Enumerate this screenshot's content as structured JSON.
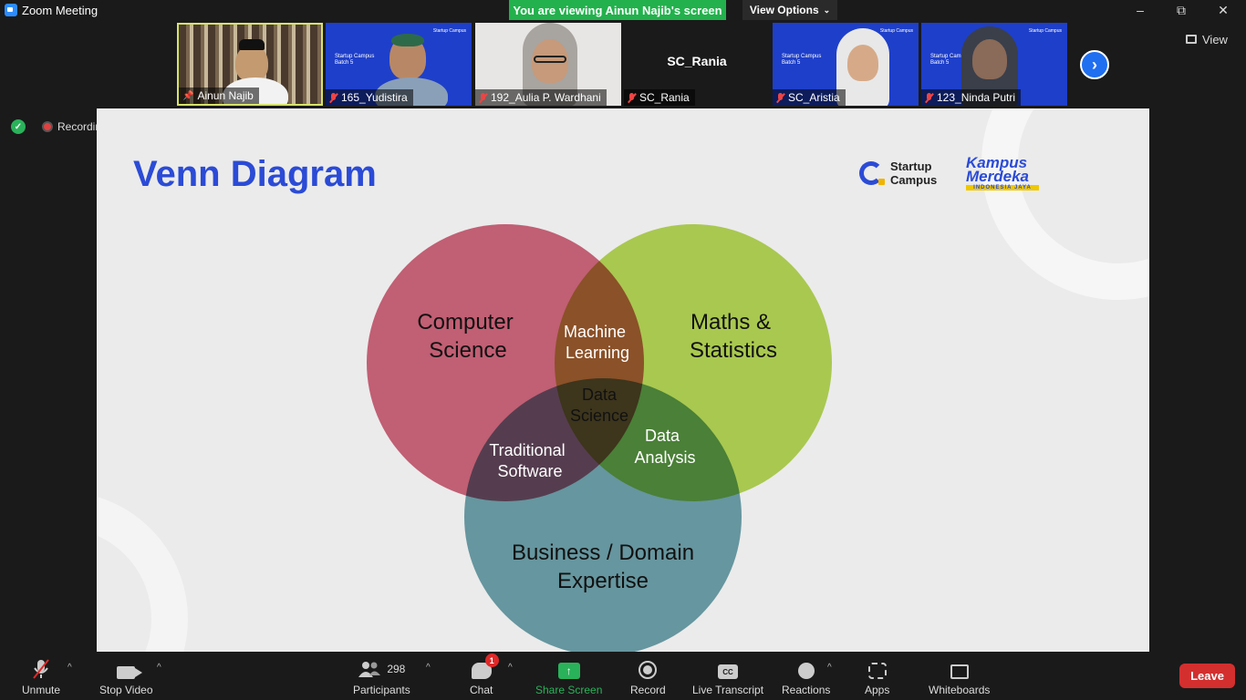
{
  "window": {
    "title": "Zoom Meeting"
  },
  "banner": {
    "text": "You are viewing Ainun Najib's screen",
    "view_options": "View Options"
  },
  "participants_strip": [
    {
      "name": "Ainun Najib",
      "muted": false,
      "pinned": true
    },
    {
      "name": "165_Yudistira",
      "muted": true
    },
    {
      "name": "192_Aulia P. Wardhani",
      "muted": true
    },
    {
      "name": "SC_Rania",
      "muted": true,
      "center_name": "SC_Rania"
    },
    {
      "name": "SC_Aristia",
      "muted": true
    },
    {
      "name": "123_Ninda Putri",
      "muted": true
    }
  ],
  "thumb_slide": {
    "title_a": "Startup Campus",
    "title_b": "Batch 5",
    "logo": "Startup Campus"
  },
  "view_button": "View",
  "status": {
    "recording": "Recording"
  },
  "slide": {
    "title": "Venn Diagram",
    "logo_startup_line1": "Startup",
    "logo_startup_line2": "Campus",
    "logo_kampus_line1": "Kampus",
    "logo_kampus_line2": "Merdeka",
    "logo_kampus_sub": "INDONESIA JAYA",
    "venn": {
      "cs_1": "Computer",
      "cs_2": "Science",
      "ms_1": "Maths &",
      "ms_2": "Statistics",
      "bd_1": "Business / Domain",
      "bd_2": "Expertise",
      "ml_1": "Machine",
      "ml_2": "Learning",
      "ds_1": "Data",
      "ds_2": "Science",
      "ts_1": "Traditional",
      "ts_2": "Software",
      "da_1": "Data",
      "da_2": "Analysis",
      "colors": {
        "cs": "#d2677e",
        "ms": "#b8d957",
        "bd": "#6fa3ad"
      }
    }
  },
  "toolbar": {
    "unmute": "Unmute",
    "stop_video": "Stop Video",
    "participants": "Participants",
    "participants_count": "298",
    "chat": "Chat",
    "chat_badge": "1",
    "share_screen": "Share Screen",
    "record": "Record",
    "live_transcript": "Live Transcript",
    "cc": "CC",
    "reactions": "Reactions",
    "apps": "Apps",
    "whiteboards": "Whiteboards",
    "leave": "Leave"
  }
}
